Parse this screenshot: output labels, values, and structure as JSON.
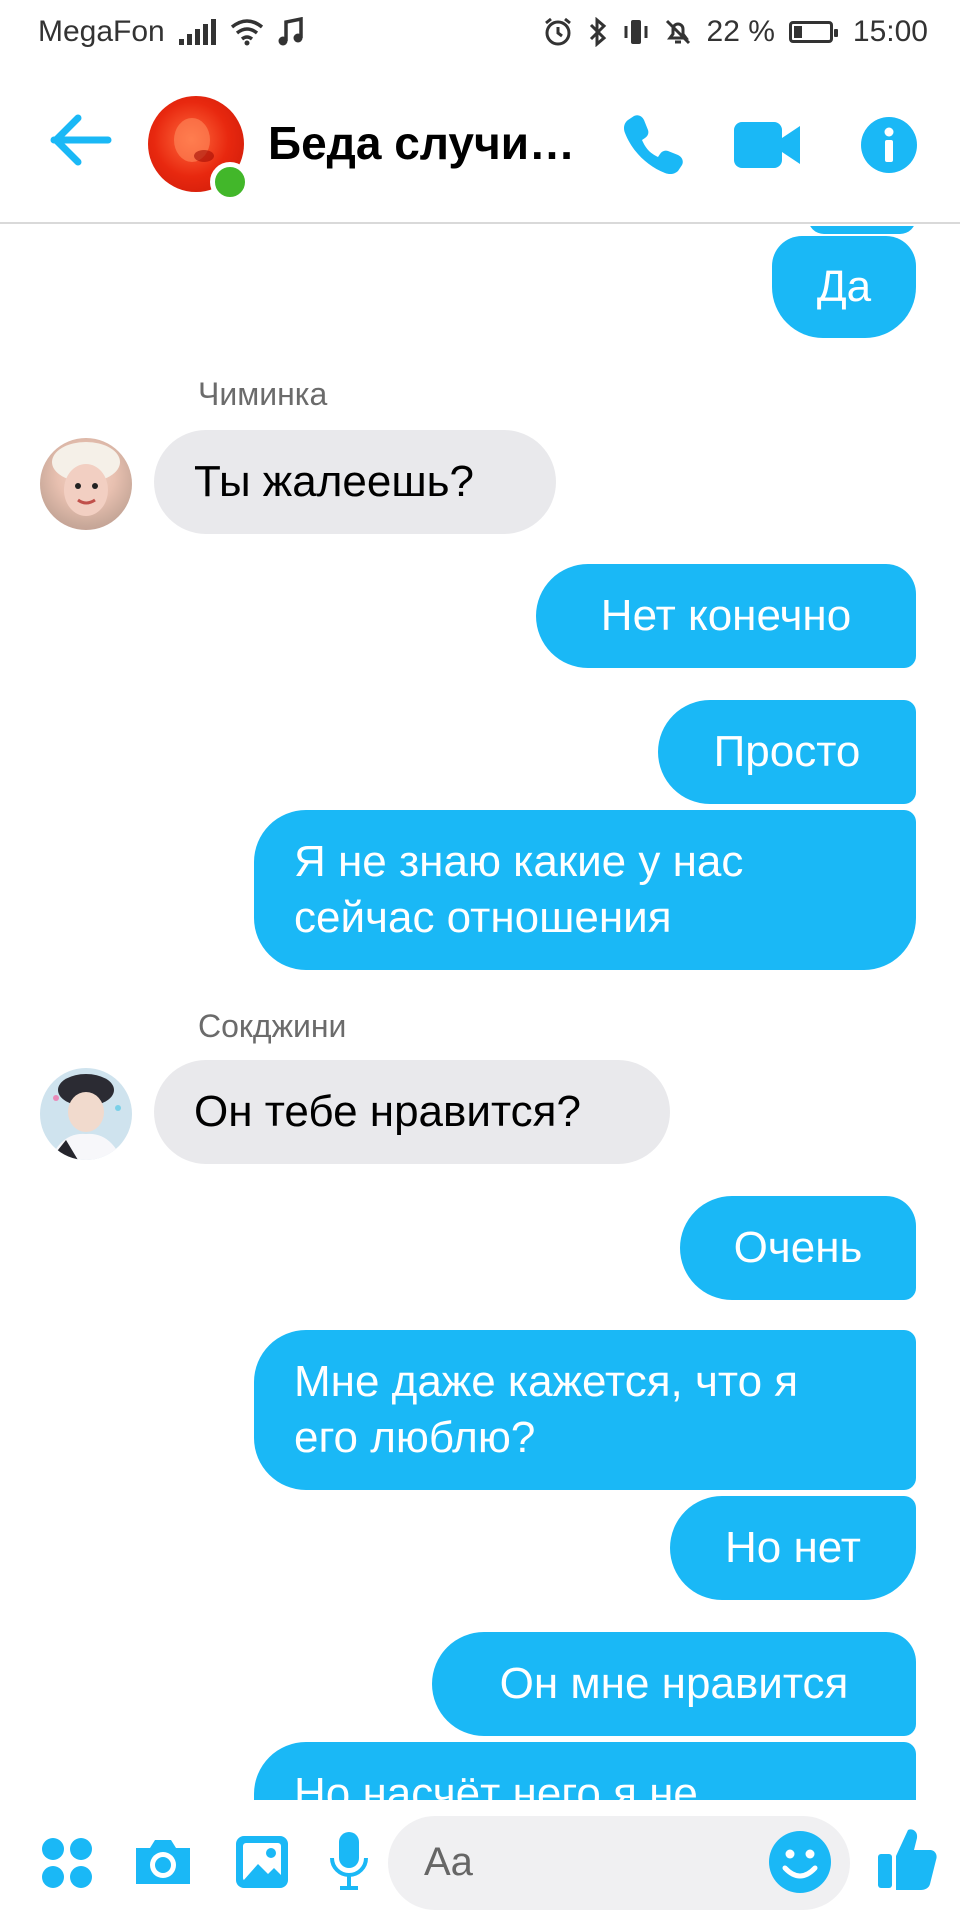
{
  "status_bar": {
    "carrier": "MegaFon",
    "battery": "22 %",
    "battery_level": 0.22,
    "time": "15:00"
  },
  "header": {
    "title": "Беда случи…",
    "back_icon": "arrow-left-icon",
    "call_icon": "phone-icon",
    "video_icon": "video-camera-icon",
    "info_icon": "info-icon"
  },
  "messages": {
    "m1": "Да",
    "sender1": "Чиминка",
    "m2": "Ты жалеешь?",
    "m3": "Нет конечно",
    "m4": "Просто",
    "m5_l1": "Я не знаю какие у нас",
    "m5_l2": "сейчас отношения",
    "sender2": "Сокджини",
    "m6": "Он тебе нравится?",
    "m7": "Очень",
    "m8_l1": "Мне даже кажется, что я",
    "m8_l2": "его люблю?",
    "m9": "Но нет",
    "m10": "Он мне нравится",
    "m11": "Но насчёт него я не"
  },
  "composer": {
    "placeholder": "Aa",
    "icons": [
      "menu-dots-icon",
      "camera-icon",
      "image-icon",
      "microphone-icon",
      "emoji-icon",
      "thumbs-up-icon"
    ]
  },
  "colors": {
    "accent": "#1ab8f6",
    "incoming": "#e9e9ec",
    "online": "#42b72a"
  }
}
